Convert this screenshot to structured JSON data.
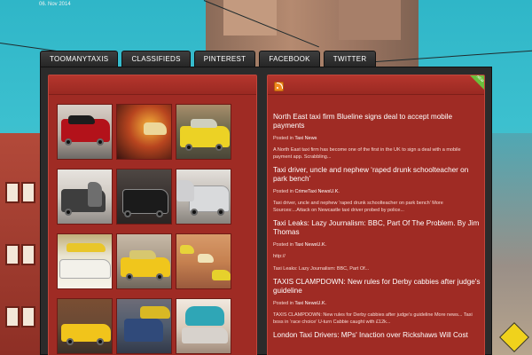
{
  "header": {
    "date": "06. Nov 2014"
  },
  "nav": {
    "tabs": [
      {
        "label": "TOOMANYTAXIS"
      },
      {
        "label": "CLASSIFIEDS"
      },
      {
        "label": "PINTEREST"
      },
      {
        "label": "FACEBOOK"
      },
      {
        "label": "TWITTER"
      }
    ]
  },
  "feed": {
    "ribbon": "NEW",
    "items": [
      {
        "title": "North East taxi firm Blueline signs deal to accept mobile payments",
        "posted_in": "Posted in",
        "category": "Taxi News",
        "desc": "A North East taxi firm has become one of the first in the UK to sign a deal with a mobile payment app. Scrabbling..."
      },
      {
        "title": "Taxi driver, uncle and nephew ‘raped drunk schoolteacher on park bench’",
        "posted_in": "Posted in",
        "category": "CrimeTaxi NewsU.K.",
        "desc": "Taxi driver, uncle and nephew ‘raped drunk schoolteacher on park bench’ More Sources:...Attack on Newcastle taxi driver probed by police..."
      },
      {
        "title": "Taxi Leaks: Lazy Journalism: BBC, Part Of The Problem. By Jim Thomas",
        "posted_in": "Posted in",
        "category": "Taxi NewsU.K.",
        "desc": "http://",
        "desc2": "Taxi Leaks: Lazy Journalism: BBC, Part Of..."
      },
      {
        "title": "TAXIS CLAMPDOWN: New rules for Derby cabbies after judge's guideline",
        "posted_in": "Posted in",
        "category": "Taxi NewsU.K.",
        "desc": "TAXIS CLAMPDOWN: New rules for Derby cabbies after judge’s guideline More news... Taxi boss in ‘race choice’ U-turn Cabbie caught with £12k..."
      },
      {
        "title": "London Taxi Drivers: MPs' Inaction over Rickshaws Will Cost",
        "posted_in": "",
        "category": "",
        "desc": ""
      }
    ]
  },
  "gallery": {
    "images": [
      {
        "name": "london-black-cab-photo"
      },
      {
        "name": "taxi-street-night-photo"
      },
      {
        "name": "yellow-taxi-photo"
      },
      {
        "name": "taxi-door-open-photo"
      },
      {
        "name": "vintage-taxi-photo"
      },
      {
        "name": "silver-cars-photo"
      },
      {
        "name": "phl-taxi-photo"
      },
      {
        "name": "yellow-cab-street-photo"
      },
      {
        "name": "taxi-rank-photo"
      },
      {
        "name": "yellow-cab-cars-photo"
      },
      {
        "name": "taxi-queue-photo"
      },
      {
        "name": "blue-taxi-photo"
      }
    ]
  }
}
